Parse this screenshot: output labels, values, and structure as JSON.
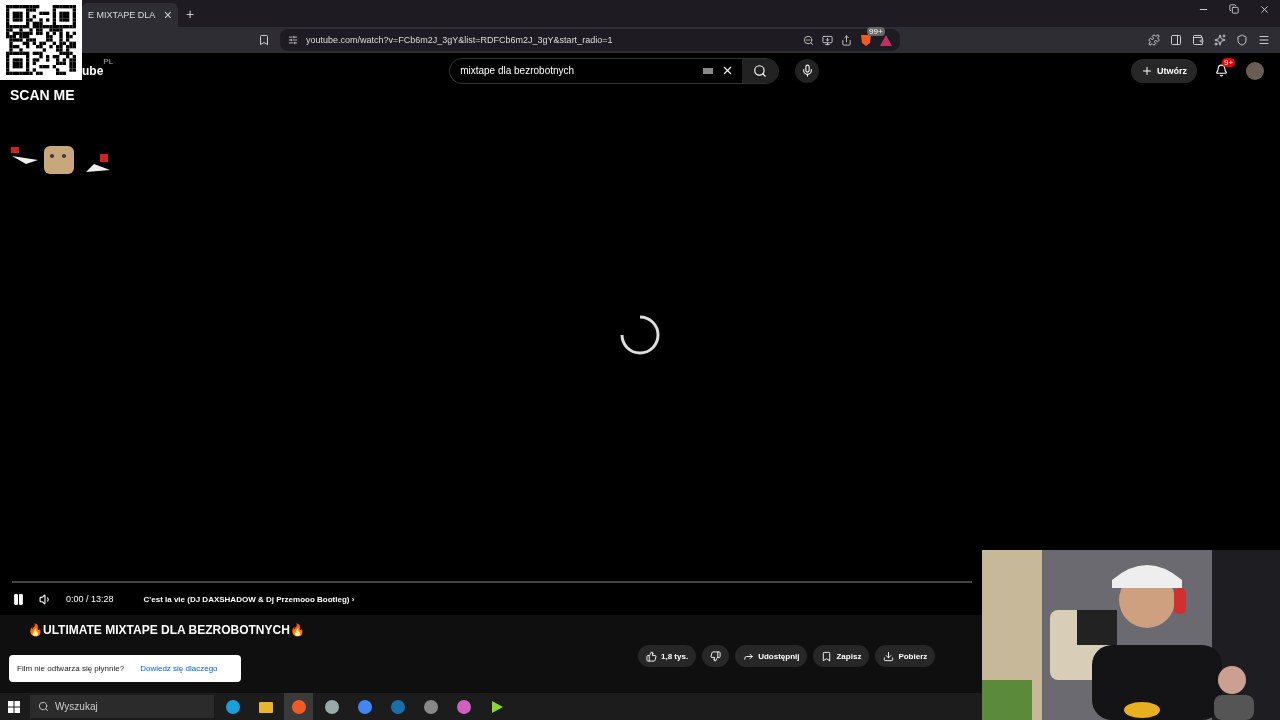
{
  "browser": {
    "tab": {
      "title": "E MIXTAPE DLA",
      "close": "×"
    },
    "new_tab": "+",
    "address": "youtube.com/watch?v=FCb6m2J_3gY&list=RDFCb6m2J_3gY&start_radio=1",
    "shields_badge": "99+"
  },
  "youtube": {
    "logo": "ube",
    "region": "PL",
    "search": {
      "value": "mixtape dla bezrobotnych"
    },
    "create_button": "Utwórz",
    "notifications": "9+"
  },
  "player": {
    "loading": true,
    "playing": true,
    "time": "0:00 / 13:28",
    "chapter": "C'est la vie (DJ DAXSHADOW & Dj Przemooo Bootleg)",
    "chapter_arrow": "›"
  },
  "video": {
    "title": "🔥ULTIMATE MIXTAPE DLA BEZROBOTNYCH🔥",
    "likes": "1,8 tys.",
    "actions": [
      {
        "kind": "share",
        "label": "Udostępnij"
      },
      {
        "kind": "save",
        "label": "Zapisz"
      },
      {
        "kind": "download",
        "label": "Pobierz"
      }
    ]
  },
  "toast": {
    "message": "Film nie odtwarza się płynnie?",
    "link": "Dowiedz się dlaczego"
  },
  "taskbar": {
    "search_placeholder": "Wyszukaj",
    "apps": [
      {
        "kind": "edge",
        "selected": false
      },
      {
        "kind": "folder",
        "selected": false
      },
      {
        "kind": "brave",
        "selected": true
      },
      {
        "kind": "app",
        "selected": false
      },
      {
        "kind": "chrome",
        "selected": false
      },
      {
        "kind": "steam",
        "selected": false
      },
      {
        "kind": "obs",
        "selected": false
      },
      {
        "kind": "chat",
        "selected": false
      },
      {
        "kind": "play",
        "selected": false
      }
    ]
  },
  "overlay": {
    "qr_label": "SCAN ME"
  }
}
